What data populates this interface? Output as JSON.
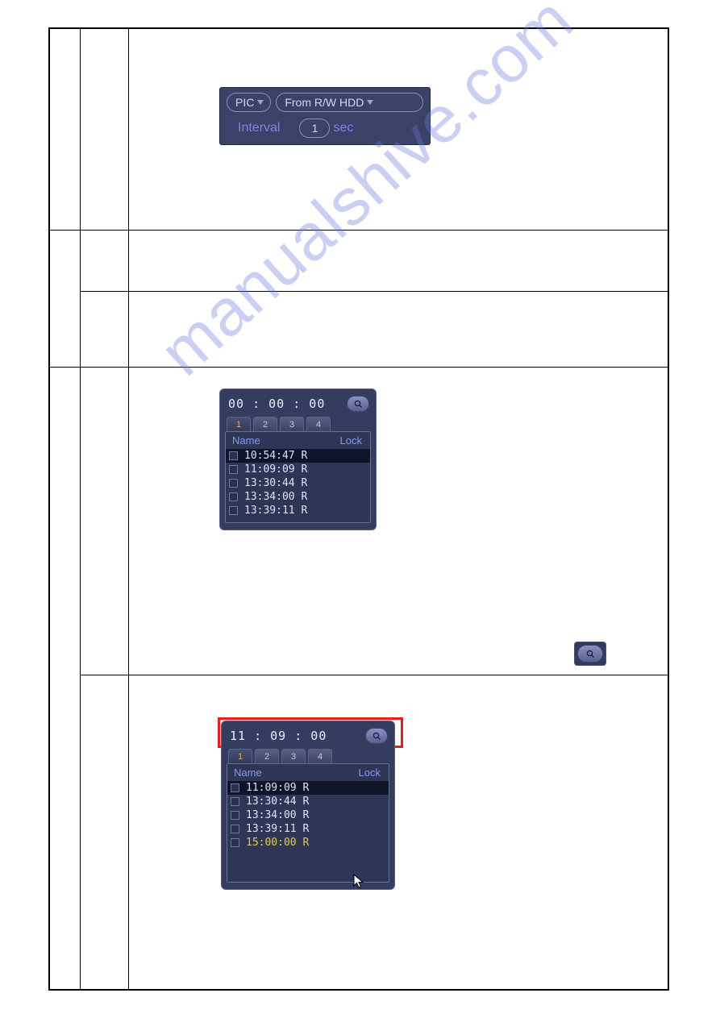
{
  "watermark": "manualshive.com",
  "panel1": {
    "dropdown1": "PIC",
    "dropdown2": "From R/W HDD",
    "interval_label": "Interval",
    "interval_value": "1",
    "sec_label": "sec"
  },
  "panel2": {
    "time": "00 : 00 : 00",
    "tabs": [
      "1",
      "2",
      "3",
      "4"
    ],
    "active_tab": 0,
    "header_name": "Name",
    "header_lock": "Lock",
    "rows": [
      {
        "time": "10:54:47",
        "flag": "R",
        "highlight": true
      },
      {
        "time": "11:09:09",
        "flag": "R"
      },
      {
        "time": "13:30:44",
        "flag": "R"
      },
      {
        "time": "13:34:00",
        "flag": "R"
      },
      {
        "time": "13:39:11",
        "flag": "R"
      }
    ]
  },
  "panel3": {
    "time": "11 : 09 : 00",
    "tabs": [
      "1",
      "2",
      "3",
      "4"
    ],
    "active_tab": 0,
    "header_name": "Name",
    "header_lock": "Lock",
    "rows": [
      {
        "time": "11:09:09",
        "flag": "R",
        "highlight": true
      },
      {
        "time": "13:30:44",
        "flag": "R"
      },
      {
        "time": "13:34:00",
        "flag": "R"
      },
      {
        "time": "13:39:11",
        "flag": "R"
      },
      {
        "time": "15:00:00",
        "flag": "R",
        "alt": true
      }
    ]
  }
}
